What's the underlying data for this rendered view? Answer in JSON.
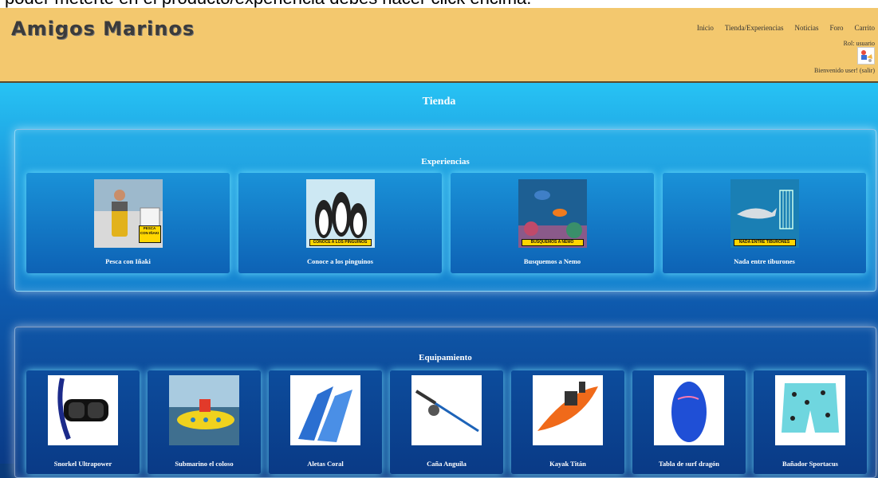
{
  "caption": "poder meterte en el producto/experiencia debes hacer click encima.",
  "brand": {
    "name": "Amigos Marinos"
  },
  "nav": {
    "items": [
      "Inicio",
      "Tienda/Experiencias",
      "Noticias",
      "Foro",
      "Carrito"
    ]
  },
  "user": {
    "role": "Rol: usuario",
    "welcome": "Bienvenido user! (salir)"
  },
  "page": {
    "title": "Tienda"
  },
  "experiences": {
    "title": "Experiencias",
    "items": [
      {
        "name": "Pesca con Iñaki",
        "banner": "PESCA CON IÑAKI"
      },
      {
        "name": "Conoce a los pinguinos",
        "banner": "CONOCE A LOS PINGÜINOS"
      },
      {
        "name": "Busquemos a Nemo",
        "banner": "BUSQUEMOS A NEMO"
      },
      {
        "name": "Nada entre tiburones",
        "banner": "NADA ENTRE TIBURONES"
      }
    ]
  },
  "equipment": {
    "title": "Equipamiento",
    "items": [
      {
        "name": "Snorkel Ultrapower",
        "icon": "snorkel-mask-icon"
      },
      {
        "name": "Submarino el coloso",
        "icon": "submarine-icon"
      },
      {
        "name": "Aletas Coral",
        "icon": "fins-icon"
      },
      {
        "name": "Caña Anguila",
        "icon": "fishing-rod-icon"
      },
      {
        "name": "Kayak Titán",
        "icon": "kayak-icon"
      },
      {
        "name": "Tabla de surf dragón",
        "icon": "surfboard-icon"
      },
      {
        "name": "Bañador Sportacus",
        "icon": "swim-shorts-icon"
      }
    ]
  }
}
